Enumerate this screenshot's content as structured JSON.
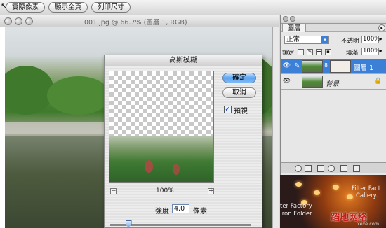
{
  "options_bar": {
    "buttons": [
      "實際像素",
      "顯示全頁",
      "列印尺寸"
    ]
  },
  "document": {
    "title": "001.jpg @ 66.7% (圖層 1, RGB)"
  },
  "dialog": {
    "title": "高斯模糊",
    "ok_label": "確定",
    "cancel_label": "取消",
    "preview_label": "預視",
    "preview_checked": true,
    "zoom": "100%",
    "zoom_out": "−",
    "zoom_in": "+",
    "radius_label": "強度",
    "radius_value": "4.0",
    "radius_unit": "像素",
    "radius_slider_fraction": 0.13
  },
  "layers": {
    "tab": "圖層",
    "blend_mode": "正常",
    "opacity_label": "不透明",
    "opacity_value": "100%",
    "lock_label": "鎖定",
    "fill_label": "填滿",
    "fill_value": "100%",
    "items": [
      {
        "name": "圖層 1",
        "selected": true
      },
      {
        "name": "背景",
        "selected": false,
        "locked": true
      }
    ]
  },
  "overlay_image": {
    "line1": "Filter Fact",
    "line2": "Callery.",
    "line3": "ter Factory",
    "line4": ".ron Folder",
    "watermark": "蹈地网络",
    "watermark_url": "xexe.com"
  },
  "colors": {
    "aqua_blue": "#5aa2ef",
    "selected_row": "#3c7fd6"
  }
}
